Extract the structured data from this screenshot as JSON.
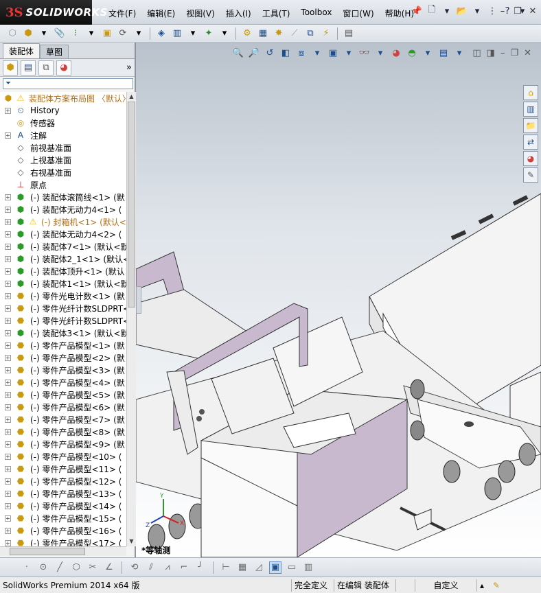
{
  "app": {
    "logo_ds": "3S",
    "logo_text": "SOLIDWORKS"
  },
  "menu": {
    "items": [
      "文件(F)",
      "编辑(E)",
      "视图(V)",
      "插入(I)",
      "工具(T)",
      "Toolbox",
      "窗口(W)",
      "帮助(H)"
    ]
  },
  "left_panel": {
    "tabs": [
      "装配体",
      "草图"
    ],
    "active_tab": "装配体",
    "more": "»",
    "filter_icon": "filter-icon"
  },
  "tree": {
    "items": [
      {
        "label": "装配体方案布局图  〈默认〉",
        "icon": "assembly-root-icon",
        "level": 0,
        "warn": true,
        "expander": false
      },
      {
        "label": "History",
        "icon": "history-icon",
        "level": 1,
        "expander": true
      },
      {
        "label": "传感器",
        "icon": "sensor-icon",
        "level": 1,
        "expander": false
      },
      {
        "label": "注解",
        "icon": "annotation-icon",
        "level": 1,
        "expander": true
      },
      {
        "label": "前视基准面",
        "icon": "plane-icon",
        "level": 1,
        "expander": false
      },
      {
        "label": "上视基准面",
        "icon": "plane-icon",
        "level": 1,
        "expander": false
      },
      {
        "label": "右视基准面",
        "icon": "plane-icon",
        "level": 1,
        "expander": false
      },
      {
        "label": "原点",
        "icon": "origin-icon",
        "level": 1,
        "expander": false
      },
      {
        "label": "(-) 装配体滚筒线<1> (默",
        "icon": "subassembly-icon",
        "level": 1,
        "expander": true
      },
      {
        "label": "(-) 装配体无动力4<1> (",
        "icon": "subassembly-icon",
        "level": 1,
        "expander": true
      },
      {
        "label": "(-) 封箱机<1> (默认<",
        "icon": "subassembly-icon",
        "level": 1,
        "expander": true,
        "warn": true
      },
      {
        "label": "(-) 装配体无动力4<2> (",
        "icon": "subassembly-icon",
        "level": 1,
        "expander": true
      },
      {
        "label": "(-) 装配体7<1> (默认<默",
        "icon": "subassembly-icon",
        "level": 1,
        "expander": true
      },
      {
        "label": "(-) 装配体2_1<1> (默认<",
        "icon": "subassembly-icon",
        "level": 1,
        "expander": true
      },
      {
        "label": "(-) 装配体顶升<1> (默认",
        "icon": "subassembly-icon",
        "level": 1,
        "expander": true
      },
      {
        "label": "(-) 装配体1<1> (默认<默",
        "icon": "subassembly-icon",
        "level": 1,
        "expander": true
      },
      {
        "label": "(-) 零件光电计数<1> (默",
        "icon": "part-icon",
        "level": 1,
        "expander": true
      },
      {
        "label": "(-) 零件光纤计数SLDPRT<",
        "icon": "part-icon",
        "level": 1,
        "expander": true
      },
      {
        "label": "(-) 零件光纤计数SLDPRT<",
        "icon": "part-icon",
        "level": 1,
        "expander": true
      },
      {
        "label": "(-) 装配体3<1> (默认<默",
        "icon": "subassembly-icon",
        "level": 1,
        "expander": true
      },
      {
        "label": "(-) 零件产品模型<1> (默",
        "icon": "part-icon",
        "level": 1,
        "expander": true
      },
      {
        "label": "(-) 零件产品模型<2> (默",
        "icon": "part-icon",
        "level": 1,
        "expander": true
      },
      {
        "label": "(-) 零件产品模型<3> (默",
        "icon": "part-icon",
        "level": 1,
        "expander": true
      },
      {
        "label": "(-) 零件产品模型<4> (默",
        "icon": "part-icon",
        "level": 1,
        "expander": true
      },
      {
        "label": "(-) 零件产品模型<5> (默",
        "icon": "part-icon",
        "level": 1,
        "expander": true
      },
      {
        "label": "(-) 零件产品模型<6> (默",
        "icon": "part-icon",
        "level": 1,
        "expander": true
      },
      {
        "label": "(-) 零件产品模型<7> (默",
        "icon": "part-icon",
        "level": 1,
        "expander": true
      },
      {
        "label": "(-) 零件产品模型<8> (默",
        "icon": "part-icon",
        "level": 1,
        "expander": true
      },
      {
        "label": "(-) 零件产品模型<9> (默",
        "icon": "part-icon",
        "level": 1,
        "expander": true
      },
      {
        "label": "(-) 零件产品模型<10> (",
        "icon": "part-icon",
        "level": 1,
        "expander": true
      },
      {
        "label": "(-) 零件产品模型<11> (",
        "icon": "part-icon",
        "level": 1,
        "expander": true
      },
      {
        "label": "(-) 零件产品模型<12> (",
        "icon": "part-icon",
        "level": 1,
        "expander": true
      },
      {
        "label": "(-) 零件产品模型<13> (",
        "icon": "part-icon",
        "level": 1,
        "expander": true
      },
      {
        "label": "(-) 零件产品模型<14> (",
        "icon": "part-icon",
        "level": 1,
        "expander": true
      },
      {
        "label": "(-) 零件产品模型<15> (",
        "icon": "part-icon",
        "level": 1,
        "expander": true
      },
      {
        "label": "(-) 零件产品模型<16> (",
        "icon": "part-icon",
        "level": 1,
        "expander": true
      },
      {
        "label": "(-) 零件产品模型<17> (",
        "icon": "part-icon",
        "level": 1,
        "expander": true
      }
    ]
  },
  "viewport": {
    "triad_label": "*等轴测"
  },
  "status": {
    "product": "SolidWorks Premium 2014 x64 版",
    "definition": "完全定义",
    "editing": "在编辑 装配体",
    "units": "自定义"
  },
  "colors": {
    "model_purple": "#c8b9cf",
    "model_gray": "#ececec",
    "accent_blue": "#1e4d8c",
    "warn_yellow": "#f2c200"
  }
}
